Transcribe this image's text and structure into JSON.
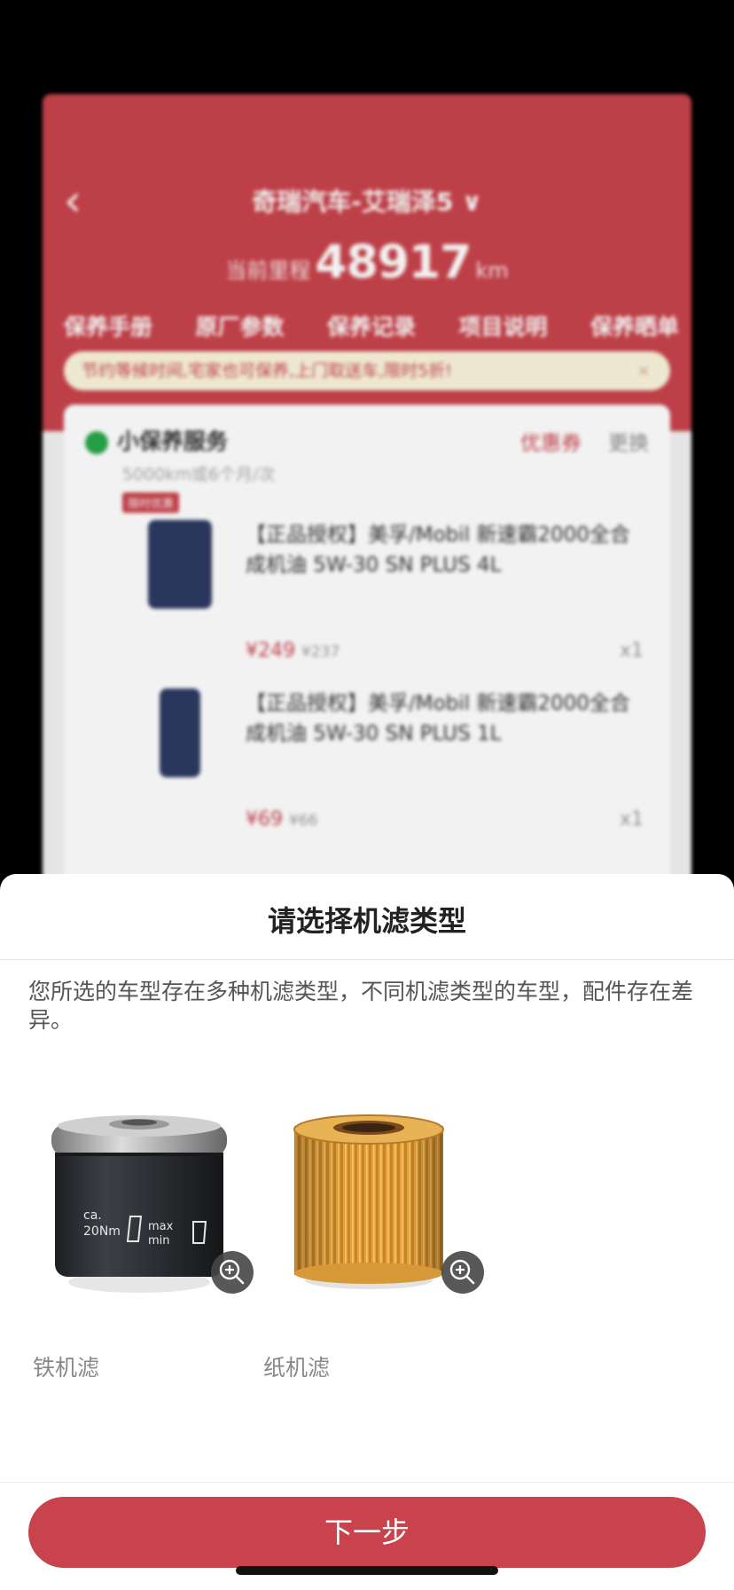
{
  "background": {
    "back_icon": "‹",
    "title": "奇瑞汽车-艾瑞泽5 ∨",
    "mileage_label": "当前里程",
    "mileage_value": "48917",
    "mileage_unit": "km",
    "tabs": [
      "保养手册",
      "原厂参数",
      "保养记录",
      "项目说明",
      "保养晒单"
    ],
    "banner_text": "节约等候时间,宅家也可保养,上门取送车,限时5折!",
    "banner_close": "×",
    "service": {
      "name": "小保养服务",
      "subtitle": "5000km或6个月/次",
      "tag": "限时优惠",
      "coupon_label": "优惠券",
      "change_label": "更换"
    },
    "products": [
      {
        "name": "【正品授权】美孚/Mobil 新速霸2000全合成机油 5W-30 SN PLUS 4L",
        "price": "¥249",
        "orig_price": "¥237",
        "qty": "x1"
      },
      {
        "name": "【正品授权】美孚/Mobil 新速霸2000全合成机油 5W-30 SN PLUS 1L",
        "price": "¥69",
        "orig_price": "¥66",
        "qty": "x1"
      }
    ]
  },
  "sheet": {
    "title": "请选择机滤类型",
    "description": "您所选的车型存在多种机滤类型，不同机滤类型的车型，配件存在差异。",
    "options": [
      {
        "label": "铁机滤",
        "icon": "metal-oil-filter-image",
        "print": [
          "ca.",
          "20Nm",
          "max",
          "min"
        ]
      },
      {
        "label": "纸机滤",
        "icon": "paper-oil-filter-image"
      }
    ],
    "next_button": "下一步"
  },
  "colors": {
    "brand_red": "#c8434b",
    "text_dark": "#222222",
    "text_gray": "#888888"
  }
}
